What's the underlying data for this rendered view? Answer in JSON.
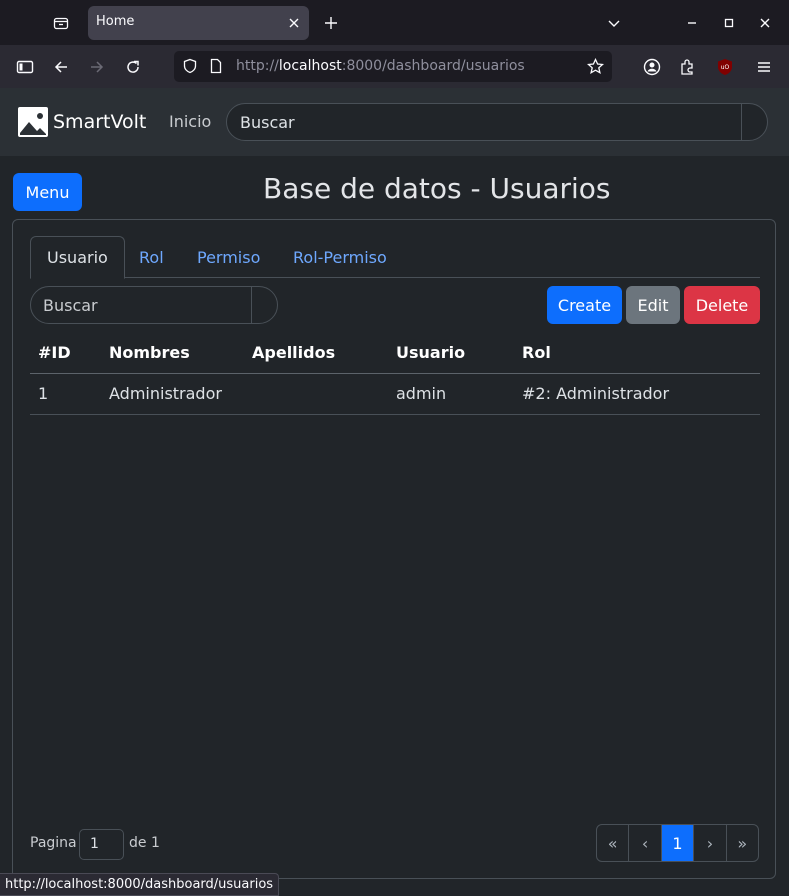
{
  "browser": {
    "tab_title": "Home",
    "url_prefix": "http://",
    "url_host": "localhost",
    "url_rest": ":8000/dashboard/usuarios",
    "status_url": "http://localhost:8000/dashboard/usuarios",
    "icons": [
      "tab-list-icon",
      "close-icon",
      "plus-icon",
      "chevron-down-icon",
      "minimize-icon",
      "maximize-icon",
      "close-icon",
      "sidebar-icon",
      "back-arrow-icon",
      "forward-arrow-icon",
      "reload-icon",
      "shield-icon",
      "page-icon",
      "star-icon",
      "account-icon",
      "extensions-icon",
      "ublock-icon",
      "menu-icon"
    ]
  },
  "app": {
    "brand": "SmartVolt",
    "nav_link": "Inicio",
    "search_placeholder": "Buscar",
    "menu_button": "Menu",
    "page_title": "Base de datos - Usuarios"
  },
  "tabs": [
    "Usuario",
    "Rol",
    "Permiso",
    "Rol-Permiso"
  ],
  "toolbar": {
    "search_placeholder": "Buscar",
    "create": "Create",
    "edit": "Edit",
    "delete": "Delete"
  },
  "table": {
    "headers": [
      "#ID",
      "Nombres",
      "Apellidos",
      "Usuario",
      "Rol"
    ],
    "rows": [
      [
        "1",
        "Administrador",
        "",
        "admin",
        "#2: Administrador"
      ]
    ]
  },
  "pagination": {
    "label_page": "Pagina",
    "current": "1",
    "label_of": "de 1",
    "first": "«",
    "prev": "‹",
    "page": "1",
    "next": "›",
    "last": "»"
  },
  "colors": {
    "primary": "#0d6efd",
    "secondary": "#6c757d",
    "danger": "#dc3545",
    "link": "#6ea8fe"
  }
}
